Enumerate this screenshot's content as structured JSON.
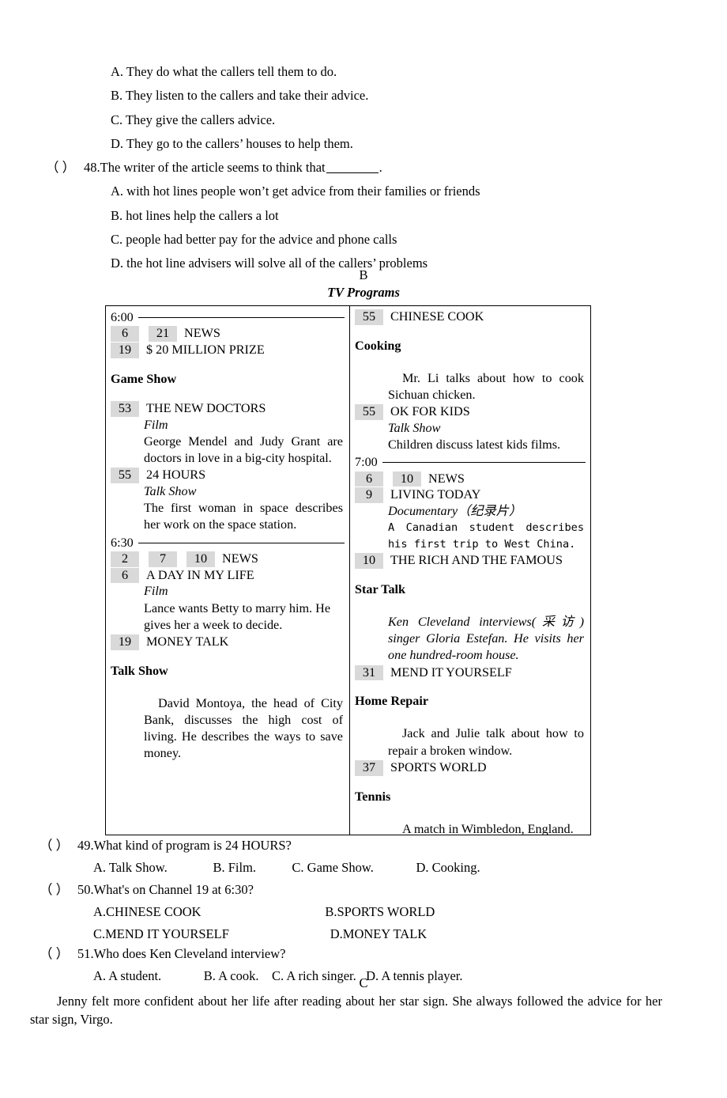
{
  "top_questions": {
    "q47_options": [
      "A. They do what the callers tell them to do.",
      "B. They listen to the callers and take their advice.",
      "C. They give the callers advice.",
      "D. They go to the callers’ houses to help them."
    ],
    "q48": {
      "paren": "（    ）",
      "number": "48.",
      "stem_before_blank": "The writer of the article seems to think that",
      "stem_after_blank": ".",
      "options": [
        "A. with hot lines people won’t get advice from their families or friends",
        "B. hot lines help the callers a lot",
        "C. people had better pay for the advice and phone calls",
        "D. the hot line advisers will solve all of the callers’ problems"
      ]
    }
  },
  "section_b": {
    "letter": "B",
    "title": "TV Programs"
  },
  "tv_table": {
    "left_column": [
      {
        "kind": "time",
        "time": "6:00"
      },
      {
        "kind": "channels",
        "channels": [
          "6",
          "21"
        ],
        "program": "NEWS"
      },
      {
        "kind": "channels",
        "channels": [
          "19"
        ],
        "program": "$ 20 MILLION PRIZE"
      },
      {
        "kind": "spacer",
        "size": "md"
      },
      {
        "kind": "genre_bold",
        "text": "Game Show"
      },
      {
        "kind": "spacer",
        "size": "md"
      },
      {
        "kind": "channels",
        "channels": [
          "53"
        ],
        "program": "THE NEW DOCTORS"
      },
      {
        "kind": "genre_italic",
        "text": "Film"
      },
      {
        "kind": "desc",
        "justify": true,
        "text": "George Mendel and Judy Grant are doctors in love in a big-city hospital."
      },
      {
        "kind": "channels",
        "channels": [
          "55"
        ],
        "program": "24 HOURS"
      },
      {
        "kind": "genre_italic",
        "text": "Talk Show"
      },
      {
        "kind": "desc",
        "justify": true,
        "text": "The first woman in space describes her work on the space station."
      },
      {
        "kind": "time",
        "time": "6:30"
      },
      {
        "kind": "channels",
        "channels": [
          "2",
          "7",
          "10"
        ],
        "program": "NEWS"
      },
      {
        "kind": "channels",
        "channels": [
          "6"
        ],
        "program": "A DAY IN MY LIFE"
      },
      {
        "kind": "genre_italic",
        "text": "Film"
      },
      {
        "kind": "desc",
        "justify": false,
        "text": "Lance wants Betty to marry him. He gives her a week to decide."
      },
      {
        "kind": "channels",
        "channels": [
          "19"
        ],
        "program": "MONEY TALK"
      },
      {
        "kind": "spacer",
        "size": "md"
      },
      {
        "kind": "genre_bold",
        "text": "Talk Show"
      },
      {
        "kind": "spacer",
        "size": "lg"
      },
      {
        "kind": "desc",
        "justify": true,
        "indent": true,
        "text": "David Montoya, the head of City Bank, discusses the high cost of living. He describes the ways to save money."
      }
    ],
    "right_column": [
      {
        "kind": "channels",
        "channels": [
          "55"
        ],
        "program": "CHINESE COOK"
      },
      {
        "kind": "spacer",
        "size": "md"
      },
      {
        "kind": "genre_bold",
        "text": "Cooking"
      },
      {
        "kind": "spacer",
        "size": "lg"
      },
      {
        "kind": "desc",
        "justify": true,
        "indent": true,
        "text": "Mr. Li talks about how to cook Sichuan chicken."
      },
      {
        "kind": "channels",
        "channels": [
          "55"
        ],
        "program": "OK FOR KIDS"
      },
      {
        "kind": "genre_italic",
        "text": "Talk Show"
      },
      {
        "kind": "desc",
        "justify": false,
        "text": "Children discuss latest kids films."
      },
      {
        "kind": "time",
        "time": "7:00"
      },
      {
        "kind": "channels",
        "channels": [
          "6",
          "10"
        ],
        "program": "NEWS"
      },
      {
        "kind": "channels",
        "channels": [
          "9"
        ],
        "program": "LIVING TODAY"
      },
      {
        "kind": "genre_italic",
        "text": "Documentary（纪录片）"
      },
      {
        "kind": "desc_mono",
        "text": "A Canadian student describes his first trip to West China."
      },
      {
        "kind": "channels",
        "channels": [
          "10"
        ],
        "program": "THE RICH AND THE FAMOUS"
      },
      {
        "kind": "spacer",
        "size": "md"
      },
      {
        "kind": "genre_bold",
        "text": "Star Talk"
      },
      {
        "kind": "spacer",
        "size": "lg"
      },
      {
        "kind": "desc_italic",
        "text": "Ken Cleveland interviews(采访) singer Gloria Estefan. He visits her one hundred-room house."
      },
      {
        "kind": "channels",
        "channels": [
          "31"
        ],
        "program": "MEND IT YOURSELF"
      },
      {
        "kind": "spacer",
        "size": "md"
      },
      {
        "kind": "genre_bold",
        "text": "Home Repair"
      },
      {
        "kind": "spacer",
        "size": "lg"
      },
      {
        "kind": "desc",
        "justify": true,
        "indent": true,
        "text": "Jack and Julie talk about how to repair a broken window."
      },
      {
        "kind": "channels",
        "channels": [
          "37"
        ],
        "program": "SPORTS WORLD"
      },
      {
        "kind": "spacer",
        "size": "md"
      },
      {
        "kind": "genre_bold",
        "text": "Tennis"
      },
      {
        "kind": "spacer",
        "size": "lg"
      },
      {
        "kind": "desc",
        "justify": false,
        "indent": true,
        "text": "A match in Wimbledon, England."
      }
    ]
  },
  "bottom_questions": [
    {
      "paren": "（",
      "paren_close": "）",
      "stem": "49.What kind of program is 24 HOURS?",
      "options_line1": "A. Talk Show.              B. Film.           C. Game Show.             D. Cooking.",
      "options_line2": null
    },
    {
      "paren": "（",
      "paren_close": "）",
      "stem": "50.What's on Channel 19 at 6:30?",
      "options_line1": "A.CHINESE COOK                                      B.SPORTS WORLD",
      "options_line2": "C.MEND IT YOURSELF                               D.MONEY TALK"
    },
    {
      "paren": "（",
      "paren_close": "）",
      "stem": "51.Who does Ken Cleveland interview?",
      "options_line1": "A. A student.             B. A cook.    C. A rich singer.   D. A tennis player.",
      "options_line2": null
    }
  ],
  "section_c": {
    "letter": "C",
    "paragraph": "Jenny felt more confident about her life after reading about her star sign. She always followed the advice for her star sign, Virgo."
  },
  "colors": {
    "channel_badge_bg": "#d9d9d9",
    "border": "#000000",
    "text": "#000000"
  }
}
